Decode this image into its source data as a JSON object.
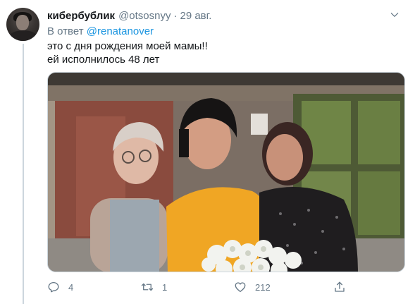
{
  "tweet": {
    "display_name": "кибербублик",
    "handle": "@otsosnyy",
    "separator": "·",
    "date": "29 авг.",
    "reply_prefix": "В ответ",
    "reply_mention": "@renatanover",
    "text_lines": [
      "это с дня рождения моей мамы!!",
      "ей исполнилось 48 лет"
    ],
    "photo_icon": "photo-three-women",
    "more_icon": "chevron-down-icon"
  },
  "actions": {
    "reply": {
      "icon": "reply-icon",
      "count": "4"
    },
    "retweet": {
      "icon": "retweet-icon",
      "count": "1"
    },
    "like": {
      "icon": "heart-icon",
      "count": "212"
    },
    "share": {
      "icon": "share-icon",
      "count": ""
    }
  },
  "colors": {
    "text": "#14171a",
    "secondary": "#657786",
    "link": "#1b95e0",
    "divider": "#ccd6dd"
  }
}
